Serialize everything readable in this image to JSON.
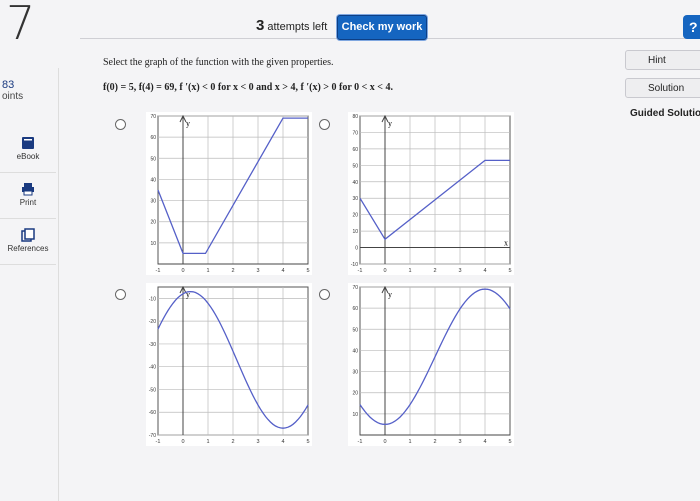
{
  "question_number": "7",
  "points": {
    "value": "83",
    "label": "oints"
  },
  "sidebar": {
    "ebook": "eBook",
    "print": "Print",
    "references": "References"
  },
  "header": {
    "attempts_count": "3",
    "attempts_label": "attempts left",
    "check_label": "Check my work",
    "help_icon_text": "?"
  },
  "right_panel": {
    "hint": "Hint",
    "solution": "Solution",
    "guided": "Guided Solutio"
  },
  "question": {
    "prompt": "Select the graph of the function with the given properties.",
    "properties": "f(0) = 5, f(4) = 69, f ′(x) < 0 for x < 0 and x > 4, f ′(x) > 0 for 0 < x < 4."
  },
  "options": [
    {
      "id": "A",
      "y_ticks": [
        "70",
        "60",
        "50",
        "40",
        "30",
        "20",
        "10"
      ],
      "x_ticks": [
        "-1",
        "0",
        "1",
        "2",
        "3",
        "4",
        "5"
      ],
      "y_axis_label": "y"
    },
    {
      "id": "B",
      "y_ticks": [
        "80",
        "70",
        "60",
        "50",
        "40",
        "30",
        "20",
        "10",
        "0",
        "-10"
      ],
      "x_ticks": [
        "-1",
        "0",
        "1",
        "2",
        "3",
        "4",
        "5"
      ],
      "y_axis_label": "y",
      "x_axis_label": "x"
    },
    {
      "id": "C",
      "y_ticks": [
        "-10",
        "-20",
        "-30",
        "-40",
        "-50",
        "-60",
        "-70"
      ],
      "x_ticks": [
        "-1",
        "0",
        "1",
        "2",
        "3",
        "4",
        "5"
      ],
      "y_axis_label": "y"
    },
    {
      "id": "D",
      "y_ticks": [
        "70",
        "60",
        "50",
        "40",
        "30",
        "20",
        "10"
      ],
      "x_ticks": [
        "-1",
        "0",
        "1",
        "2",
        "3",
        "4",
        "5"
      ],
      "y_axis_label": "y"
    }
  ]
}
